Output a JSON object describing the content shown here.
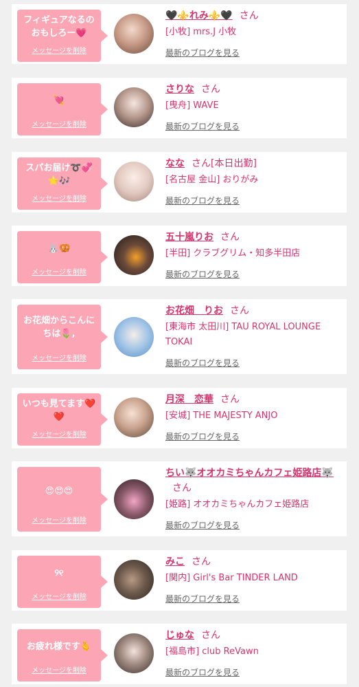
{
  "delete_label": "メッセージを削除",
  "blog_label": "最新のブログを見る",
  "san": "さん",
  "cards": [
    {
      "message": "フィギュアなるの\nおもしろー💗",
      "name": "🖤⚜️れみ⚜️🖤",
      "status": "",
      "shop": "[小牧] mrs.J 小牧"
    },
    {
      "message": "💘",
      "name": "さりな",
      "status": "",
      "shop": "[曳舟] WAVE"
    },
    {
      "message": "スパお届け➰💞\n⭐🎶",
      "name": "なな",
      "status": "[本日出勤]",
      "shop": "[名古屋 金山] おりがみ"
    },
    {
      "message": "🐰🥨",
      "name": "五十嵐りお",
      "status": "",
      "shop": "[半田] クラブグリム・知多半田店"
    },
    {
      "message": "お花畑からこんに\nちは🌷,",
      "name": "お花畑　りお",
      "status": "",
      "shop": "[東海市 太田川] TAU ROYAL LOUNGE TOKAI"
    },
    {
      "message": "いつも見てます❤️\n❤️",
      "name": "月深　恋華",
      "status": "",
      "shop": "[安城] THE MAJESTY ANJO"
    },
    {
      "message": "😍😍😍",
      "name": "ちい🐺オオカミちゃんカフェ姫路店🐺",
      "status": "",
      "shop": "[姫路] オオカミちゃんカフェ姫路店"
    },
    {
      "message": "୨୧",
      "name": "みこ",
      "status": "",
      "shop": "[関内] Girl's Bar TINDER LAND"
    },
    {
      "message": "お疲れ様です🫰",
      "name": "じゅな",
      "status": "",
      "shop": "[福島市] club ReVawn"
    }
  ]
}
